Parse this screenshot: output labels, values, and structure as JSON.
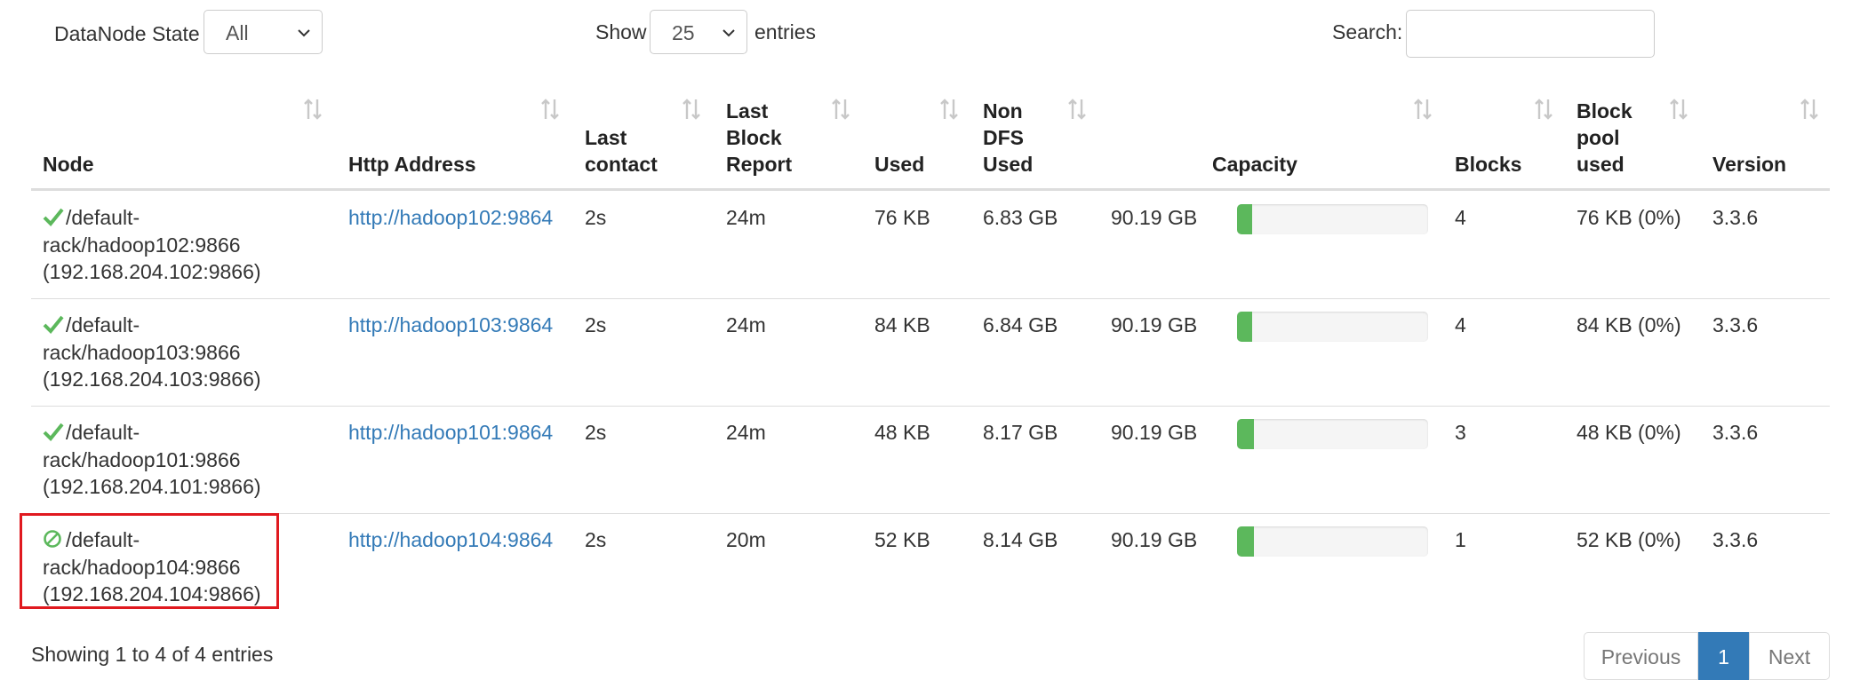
{
  "filters": {
    "state_label": "DataNode State",
    "state_value": "All",
    "show_label": "Show",
    "show_value": "25",
    "entries_label": "entries",
    "search_label": "Search:",
    "search_value": ""
  },
  "table": {
    "headers": {
      "node": "Node",
      "http": "Http Address",
      "last_contact": [
        "Last",
        "contact"
      ],
      "last_block": [
        "Last",
        "Block",
        "Report"
      ],
      "used": "Used",
      "non_dfs": [
        "Non",
        "DFS",
        "Used"
      ],
      "capacity": "Capacity",
      "blocks": "Blocks",
      "pool": [
        "Block",
        "pool",
        "used"
      ],
      "version": "Version"
    },
    "rows": [
      {
        "status": "in-service",
        "node": [
          "/default-",
          "rack/hadoop102:9866",
          "(192.168.204.102:9866)"
        ],
        "http": "http://hadoop102:9864",
        "last_contact": "2s",
        "last_block": "24m",
        "used": "76 KB",
        "non_dfs": "6.83 GB",
        "capacity": "90.19 GB",
        "capacity_used_fraction": 0.08,
        "blocks": "4",
        "pool": "76 KB (0%)",
        "version": "3.3.6"
      },
      {
        "status": "in-service",
        "node": [
          "/default-",
          "rack/hadoop103:9866",
          "(192.168.204.103:9866)"
        ],
        "http": "http://hadoop103:9864",
        "last_contact": "2s",
        "last_block": "24m",
        "used": "84 KB",
        "non_dfs": "6.84 GB",
        "capacity": "90.19 GB",
        "capacity_used_fraction": 0.08,
        "blocks": "4",
        "pool": "84 KB (0%)",
        "version": "3.3.6"
      },
      {
        "status": "in-service",
        "node": [
          "/default-",
          "rack/hadoop101:9866",
          "(192.168.204.101:9866)"
        ],
        "http": "http://hadoop101:9864",
        "last_contact": "2s",
        "last_block": "24m",
        "used": "48 KB",
        "non_dfs": "8.17 GB",
        "capacity": "90.19 GB",
        "capacity_used_fraction": 0.09,
        "blocks": "3",
        "pool": "48 KB (0%)",
        "version": "3.3.6"
      },
      {
        "status": "decommissioned",
        "node": [
          "/default-",
          "rack/hadoop104:9866",
          "(192.168.204.104:9866)"
        ],
        "http": "http://hadoop104:9864",
        "last_contact": "2s",
        "last_block": "20m",
        "used": "52 KB",
        "non_dfs": "8.14 GB",
        "capacity": "90.19 GB",
        "capacity_used_fraction": 0.09,
        "blocks": "1",
        "pool": "52 KB (0%)",
        "version": "3.3.6"
      }
    ]
  },
  "footer": {
    "info": "Showing 1 to 4 of 4 entries",
    "prev": "Previous",
    "page": "1",
    "next": "Next"
  },
  "colors": {
    "link": "#337ab7",
    "ok_green": "#5cb85c",
    "highlight_red": "#e0191f",
    "pager_active": "#337ab7"
  }
}
